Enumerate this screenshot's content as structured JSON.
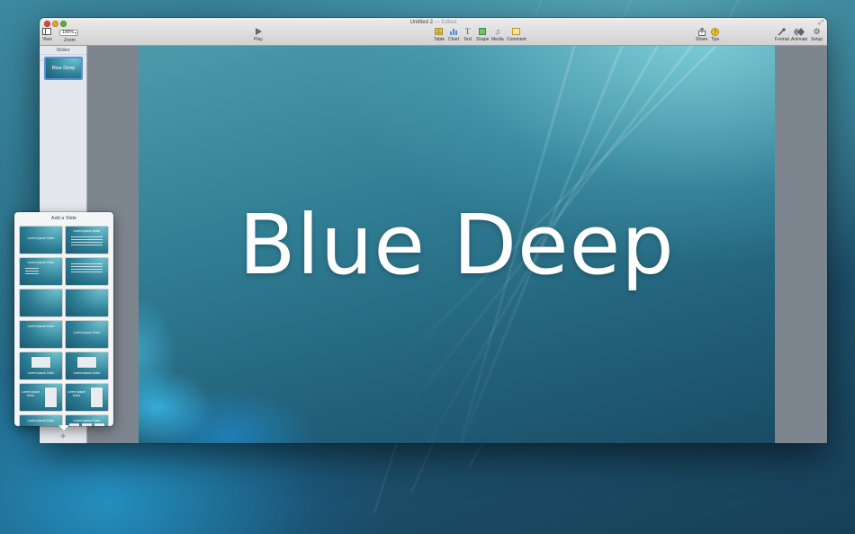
{
  "window": {
    "title": "Untitled 2",
    "title_status": "— Edited"
  },
  "toolbar": {
    "view_label": "View",
    "zoom_value": "100%",
    "zoom_label": "Zoom",
    "play_label": "Play",
    "table_label": "Table",
    "chart_label": "Chart",
    "text_label": "Text",
    "shape_label": "Shape",
    "media_label": "Media",
    "comment_label": "Comment",
    "share_label": "Share",
    "tips_label": "Tips",
    "format_label": "Format",
    "animate_label": "Animate",
    "setup_label": "Setup",
    "icons": {
      "view": "sidebar-view-icon",
      "play": "play-triangle-icon",
      "table": "table-grid-icon",
      "chart": "bar-chart-icon",
      "text": "text-t-icon",
      "shape": "square-shape-icon",
      "media": "music-note-icon",
      "comment": "speech-note-icon",
      "share": "share-arrow-icon",
      "tips": "question-icon",
      "format": "paintbrush-icon",
      "animate": "diamond-animate-icon",
      "setup": "gear-icon"
    }
  },
  "sidebar": {
    "header": "Slides",
    "slides": [
      {
        "number": "1",
        "title": "Blue Deep"
      }
    ]
  },
  "slide": {
    "title": "Blue Deep"
  },
  "add_slide_popover": {
    "title": "Add a Slide",
    "layouts": [
      {
        "top": "Lorem Ipsum Dolor",
        "bottom": ""
      },
      {
        "top": "Lorem Ipsum Dolor",
        "bottom": ""
      },
      {
        "top": "Lorem Ipsum Dolor",
        "bottom": ""
      },
      {
        "top": "",
        "bottom": ""
      },
      {
        "top": "",
        "bottom": ""
      },
      {
        "top": "",
        "bottom": ""
      },
      {
        "top": "Lorem Ipsum Dolor",
        "bottom": ""
      },
      {
        "top": "Lorem Ipsum Dolor",
        "bottom": ""
      },
      {
        "top": "",
        "bottom": "Lorem Ipsum Dolor"
      },
      {
        "top": "",
        "bottom": "Lorem Ipsum Dolor"
      },
      {
        "top": "Lorem Ipsum Dolor",
        "bottom": ""
      },
      {
        "top": "Lorem Ipsum Dolor",
        "bottom": ""
      },
      {
        "top": "Lorem Ipsum Dolor",
        "bottom": ""
      },
      {
        "top": "Lorem Ipsum Dolor",
        "bottom": ""
      }
    ]
  },
  "colors": {
    "accent": "#5b8fd9",
    "close": "#e0443e",
    "minimize": "#dea236",
    "maximize": "#57b13c"
  }
}
